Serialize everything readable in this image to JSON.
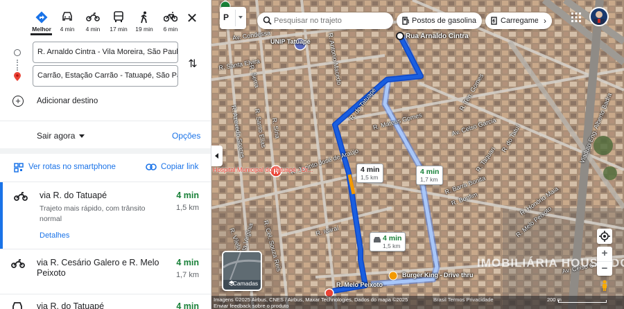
{
  "modes": [
    {
      "name": "Melhor",
      "time": "",
      "icon": "best-route-icon"
    },
    {
      "name": "carro",
      "time": "4 min",
      "icon": "car-icon"
    },
    {
      "name": "moto",
      "time": "4 min",
      "icon": "motorcycle-icon"
    },
    {
      "name": "transporte",
      "time": "17 min",
      "icon": "bus-icon"
    },
    {
      "name": "a pé",
      "time": "19 min",
      "icon": "walk-icon"
    },
    {
      "name": "bicicleta",
      "time": "6 min",
      "icon": "bicycle-icon"
    }
  ],
  "labels": {
    "best": "Melhor",
    "car_time": "4 min",
    "moto_time": "4 min",
    "transit_time": "17 min",
    "walk_time": "19 min",
    "bike_time": "6 min"
  },
  "inputs": {
    "origin": "R. Arnaldo Cintra - Vila Moreira, São Paulo",
    "destination": "Carrão, Estação Carrão - Tatuapé, São Paulo"
  },
  "add_destination": "Adicionar destino",
  "depart": {
    "label": "Sair agora",
    "options": "Opções"
  },
  "share": {
    "send": "Ver rotas no smartphone",
    "copy": "Copiar link"
  },
  "routes": [
    {
      "title": "via R. do Tatuapé",
      "time": "4 min",
      "distance": "1,5 km",
      "desc": "Trajeto mais rápido, com trânsito normal",
      "details": "Detalhes"
    },
    {
      "title": "via R. Cesário Galero e R. Melo Peixoto",
      "time": "4 min",
      "distance": "1,7 km"
    },
    {
      "title": "via R. do Tatuapé",
      "time": "4 min"
    }
  ],
  "map": {
    "layer_label": "P",
    "search_placeholder": "Pesquisar no trajeto",
    "chip_gas": "Postos de gasolina",
    "chip_charge": "Carregamento",
    "layers_label": "Camadas",
    "origin_label": "Rua Arnaldo Cintra",
    "unip": "UNIP\nTatuapé",
    "hospital": "Hospital Municipal do Tatuapé - Dr...",
    "info_main": {
      "time": "4 min",
      "dist": "1,5 km"
    },
    "info_alt": {
      "time": "4 min",
      "dist": "1,7 km"
    },
    "info_car": {
      "time": "4 min",
      "dist": "1,5 km"
    },
    "streets": [
      "Av. Condessa",
      "R. Santa Elvira",
      "R. Antonio Macedo",
      "R. Azevedo Soares",
      "R. Serra",
      "R. Santo Elias",
      "R. Síria",
      "R. Santa Virgínia",
      "R. do Tatuapé",
      "R. Mateus Gomes",
      "R. Jacinto José de Araújo",
      "Av. Celso Garcia",
      "R. Taquari",
      "R. Barra Bonita",
      "R. Bonfim",
      "R. Honório Maia",
      "R. Melo Peixoto",
      "R. Icaraí",
      "R. Cel. Souza Reis",
      "R. Vilela",
      "R. Ten. Gomes",
      "R. do Tatuí",
      "Viaduto Eng. Alberto Badra",
      "Av. Celso Garcia"
    ],
    "destination_label": "R. Melo Peixoto",
    "burger": "Burger King - Drive thru",
    "watermark": "IMOBILIÁRIA HOUSE DO BRASIL",
    "attribution": "Imagens ©2025 Airbus, CNES / Airbus, Maxar Technologies, Dados do mapa ©2025",
    "feedback": "Enviar feedback sobre o produto",
    "terms": "Brasil   Termos   Privacidade",
    "scale": "200 m"
  },
  "colors": {
    "accent": "#1a73e8",
    "route_main": "#1a5fe0",
    "route_alt": "#a8c7fa",
    "time_green": "#188038",
    "traffic_orange": "#f29900"
  }
}
